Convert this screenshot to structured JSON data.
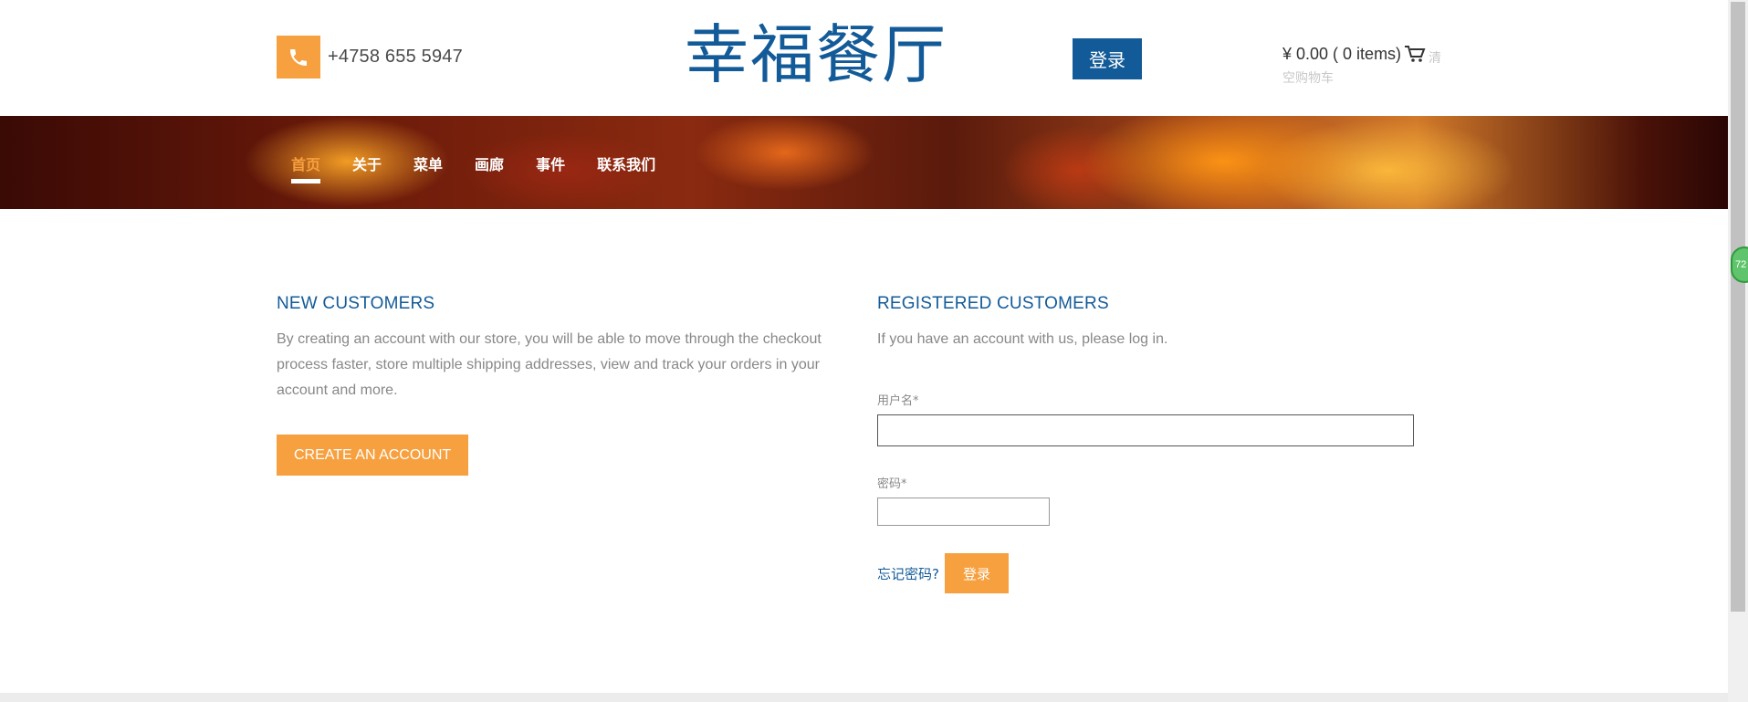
{
  "header": {
    "phone_icon": "phone-icon",
    "phone_number": "+4758 655 5947",
    "logo_text": "幸福餐厅",
    "login_button": "登录",
    "cart_total": "¥ 0.00 ( 0 items)",
    "cart_icon": "cart-icon",
    "cart_clear_1": "清",
    "cart_clear_2": "空购物车"
  },
  "nav": {
    "items": [
      {
        "label": "首页",
        "active": true
      },
      {
        "label": "关于"
      },
      {
        "label": "菜单"
      },
      {
        "label": "画廊"
      },
      {
        "label": "事件"
      },
      {
        "label": "联系我们"
      }
    ]
  },
  "new_customers": {
    "title": "NEW CUSTOMERS",
    "text": "By creating an account with our store, you will be able to move through the checkout process faster, store multiple shipping addresses, view and track your orders in your account and more.",
    "button": "CREATE AN ACCOUNT"
  },
  "registered": {
    "title": "REGISTERED CUSTOMERS",
    "text": "If you have an account with us, please log in.",
    "username_label": "用户名*",
    "username_value": "",
    "password_label": "密码*",
    "password_value": "",
    "forgot_link": "忘记密码?",
    "login_button": "登录"
  },
  "float_badge": "72",
  "colors": {
    "brand_blue": "#135b98",
    "accent_orange": "#f7a03f"
  }
}
